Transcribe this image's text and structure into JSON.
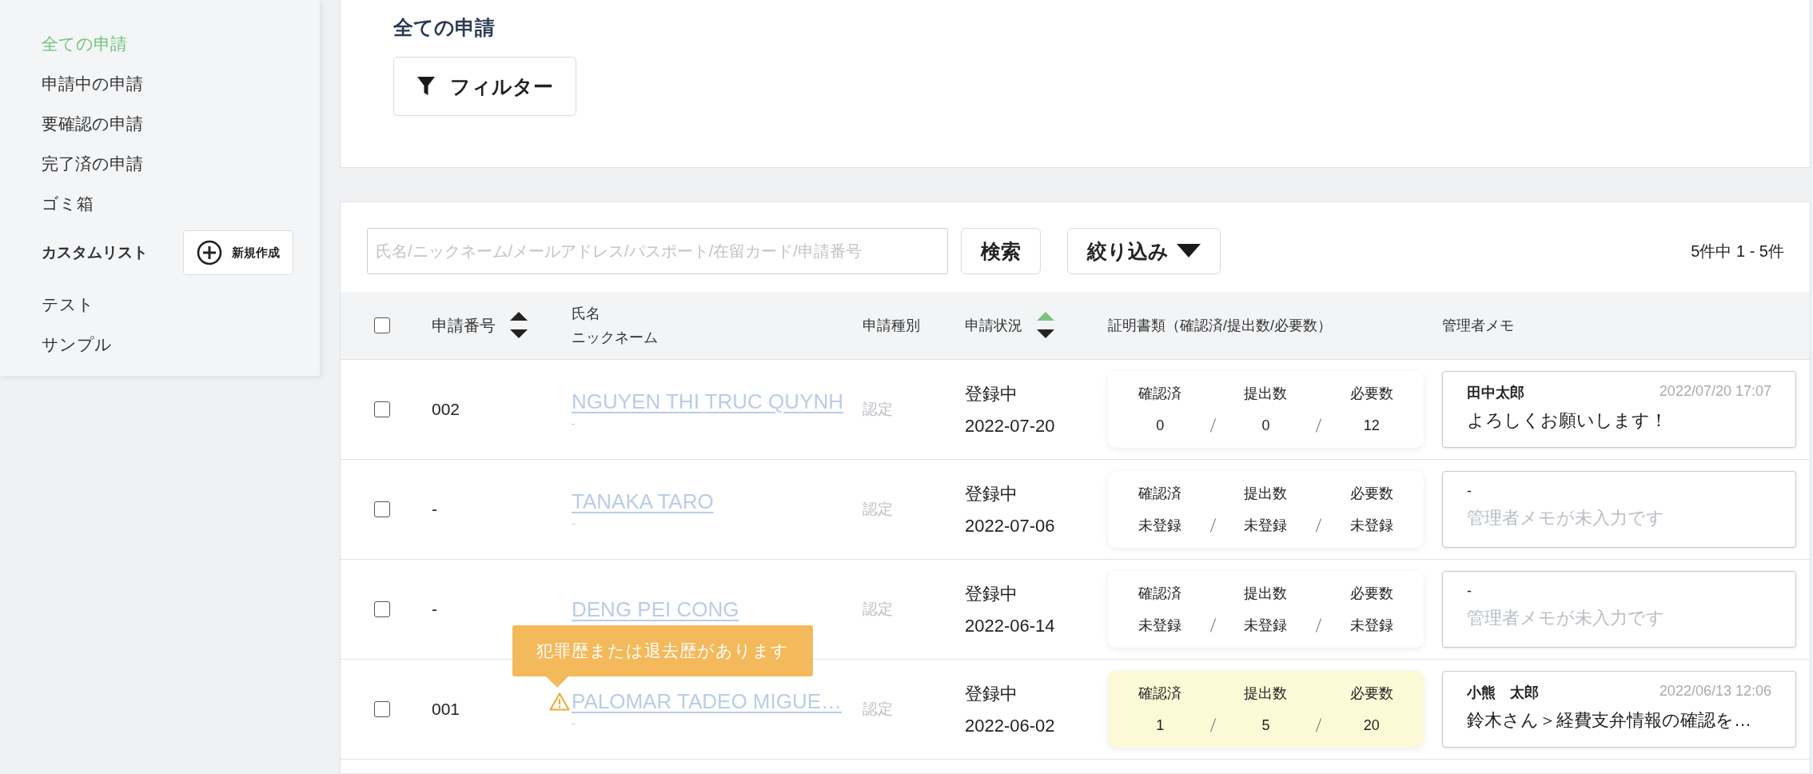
{
  "sidebar": {
    "items": [
      {
        "label": "全ての申請",
        "selected": true
      },
      {
        "label": "申請中の申請",
        "selected": false
      },
      {
        "label": "要確認の申請",
        "selected": false
      },
      {
        "label": "完了済の申請",
        "selected": false
      },
      {
        "label": "ゴミ箱",
        "selected": false
      }
    ],
    "custom_list": {
      "title": "カスタムリスト",
      "button": "新規作成",
      "items": [
        {
          "label": "テスト",
          "selected": false
        },
        {
          "label": "サンプル",
          "selected": false
        }
      ]
    }
  },
  "header": {
    "title": "全ての申請",
    "filter_button": "フィルター"
  },
  "toolbar": {
    "search": {
      "placeholder": "氏名/ニックネーム/メールアドレス/パスポート/在留カード/申請番号"
    },
    "search_button": "検索",
    "narrow_button": "絞り込み",
    "count": "5件中 1 -  5件"
  },
  "table": {
    "select_all": {
      "checked": false
    },
    "columns": [
      {
        "label": "申請番号",
        "sort_active": false
      },
      {
        "label": "氏名",
        "sublabel": "ニックネーム"
      },
      {
        "label": "申請種別"
      },
      {
        "label": "申請状況",
        "sort_active": true
      },
      {
        "label": "証明書類（確認済/提出数/必要数）"
      },
      {
        "label": "管理者メモ"
      }
    ],
    "rows": [
      {
        "checked": false,
        "number": "002",
        "name": "NGUYEN THI TRUC QUYNH",
        "nickname": "-",
        "type": "認定",
        "status": "登録中",
        "date": "2022-07-20",
        "docs": {
          "highlighted": false,
          "labels": [
            "確認済",
            "提出数",
            "必要数"
          ],
          "values": [
            "0",
            "0",
            "12"
          ]
        },
        "memo": {
          "kind": "note",
          "author": "田中太郎",
          "time": "2022/07/20 17:07",
          "text": "よろしくお願いします！"
        }
      },
      {
        "checked": false,
        "number": "-",
        "name": "TANAKA TARO",
        "nickname": "-",
        "type": "認定",
        "status": "登録中",
        "date": "2022-07-06",
        "docs": {
          "highlighted": false,
          "labels": [
            "確認済",
            "提出数",
            "必要数"
          ],
          "values": [
            "未登録",
            "未登録",
            "未登録"
          ]
        },
        "memo": {
          "kind": "empty",
          "author": "-",
          "text": "管理者メモが未入力です"
        }
      },
      {
        "checked": false,
        "number": "-",
        "name": "DENG PEI CONG",
        "type": "認定",
        "status": "登録中",
        "date": "2022-06-14",
        "docs": {
          "highlighted": false,
          "labels": [
            "確認済",
            "提出数",
            "必要数"
          ],
          "values": [
            "未登録",
            "未登録",
            "未登録"
          ]
        },
        "memo": {
          "kind": "empty",
          "author": "-",
          "text": "管理者メモが未入力です"
        }
      },
      {
        "checked": false,
        "number": "001",
        "name": "PALOMAR TADEO MIGUE…",
        "nickname": "-",
        "warning": {
          "tooltip": "犯罪歴または退去歴があります"
        },
        "type": "認定",
        "status": "登録中",
        "date": "2022-06-02",
        "docs": {
          "highlighted": true,
          "labels": [
            "確認済",
            "提出数",
            "必要数"
          ],
          "values": [
            "1",
            "5",
            "20"
          ]
        },
        "memo": {
          "kind": "note",
          "author": "小熊　太郎",
          "time": "2022/06/13 12:06",
          "text": "鈴木さん＞経費支弁情報の確認を…"
        }
      }
    ]
  }
}
